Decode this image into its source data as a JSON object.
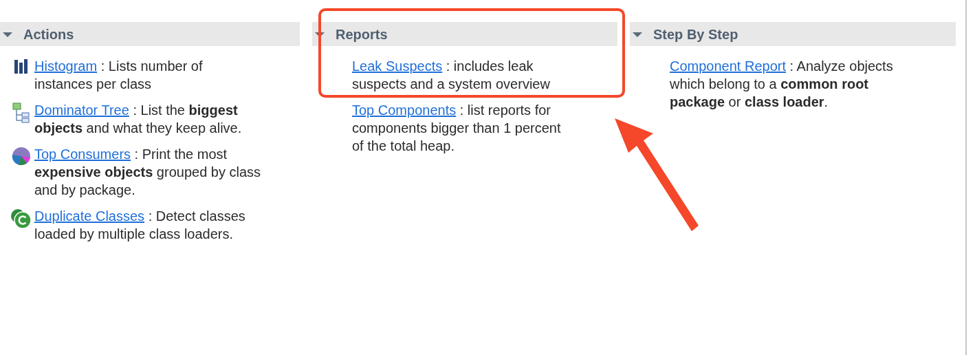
{
  "sections": [
    {
      "title": "Actions",
      "expanded": true,
      "items": [
        {
          "kind": "histogram",
          "link": "Histogram",
          "text": " : Lists number of instances per class"
        },
        {
          "kind": "tree",
          "link": "Dominator Tree",
          "text": " : List the  **biggest objects** and what they keep alive."
        },
        {
          "kind": "pie",
          "link": "Top Consumers",
          "text": " : Print the most **expensive objects** grouped by class and by package."
        },
        {
          "kind": "duplicate",
          "link": "Duplicate Classes",
          "text": " : Detect classes loaded by multiple class loaders."
        }
      ]
    },
    {
      "title": "Reports",
      "expanded": true,
      "items": [
        {
          "kind": "none",
          "link": "Leak Suspects",
          "text": " : includes leak suspects and a system overview"
        },
        {
          "kind": "none",
          "link": "Top Components",
          "text": " : list reports for components bigger than 1 percent of the total heap."
        }
      ]
    },
    {
      "title": "Step By Step",
      "expanded": true,
      "items": [
        {
          "kind": "none",
          "link": "Component Report",
          "text": " : Analyze objects which belong to a **common root package** or **class loader**."
        }
      ]
    }
  ]
}
